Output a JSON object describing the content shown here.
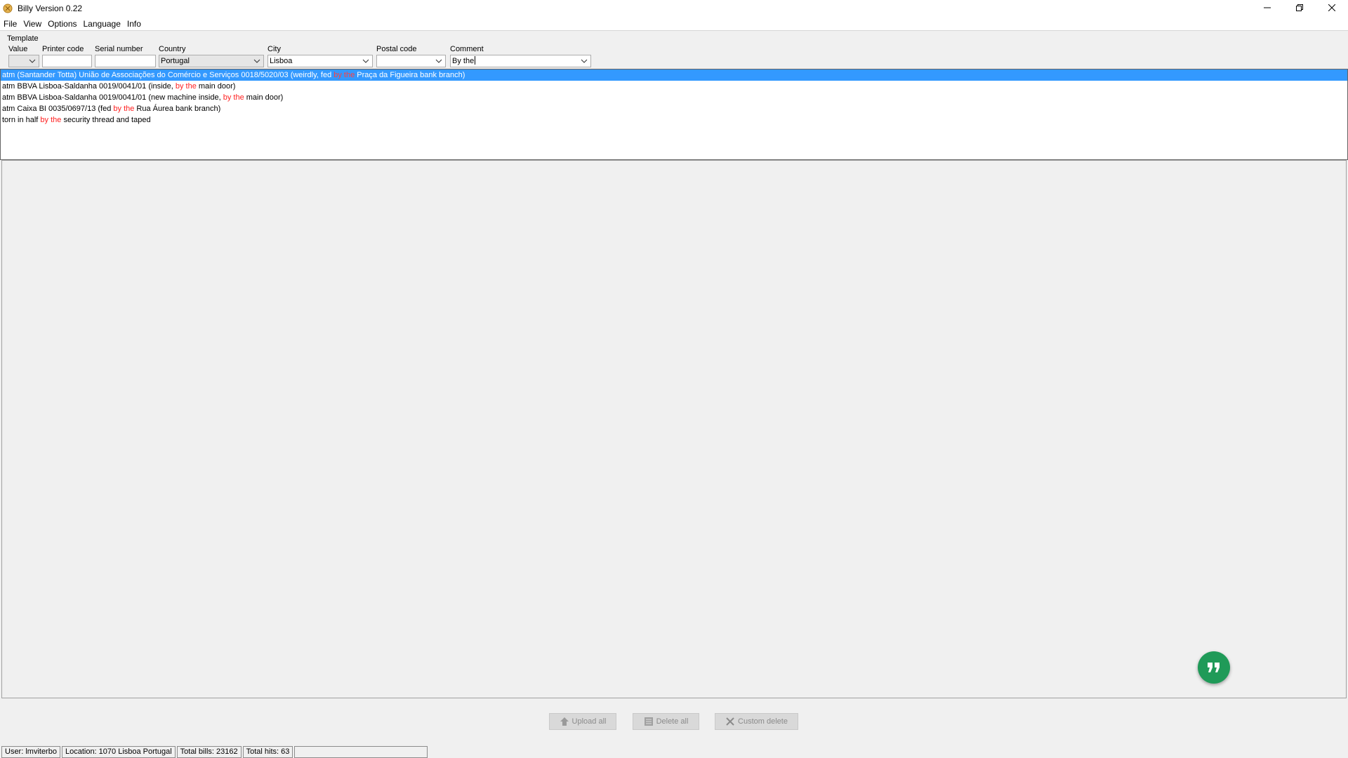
{
  "window": {
    "title": "Billy Version 0.22",
    "app_icon": "billy-app-icon",
    "controls": [
      "minimize-icon",
      "restore-icon",
      "close-icon"
    ]
  },
  "menu": {
    "items": [
      "File",
      "View",
      "Options",
      "Language",
      "Info"
    ]
  },
  "template": {
    "title": "Template",
    "fields": {
      "value": {
        "label": "Value",
        "value": ""
      },
      "printer_code": {
        "label": "Printer code",
        "value": ""
      },
      "serial_number": {
        "label": "Serial number",
        "value": ""
      },
      "country": {
        "label": "Country",
        "value": "Portugal"
      },
      "city": {
        "label": "City",
        "value": "Lisboa"
      },
      "postal_code": {
        "label": "Postal code",
        "value": ""
      },
      "comment": {
        "label": "Comment",
        "value": "By the"
      }
    }
  },
  "suggestions": [
    {
      "before": "atm (Santander Totta) União de Associações do Comércio e Serviços 0018/5020/03 (weirdly, fed ",
      "match": "by the",
      "after": " Praça da Figueira bank branch)",
      "selected": true
    },
    {
      "before": "atm BBVA Lisboa-Saldanha 0019/0041/01 (inside, ",
      "match": "by the",
      "after": " main door)",
      "selected": false
    },
    {
      "before": "atm BBVA Lisboa-Saldanha 0019/0041/01 (new machine inside, ",
      "match": "by the",
      "after": " main door)",
      "selected": false
    },
    {
      "before": "atm Caixa BI 0035/0697/13 (fed ",
      "match": "by the",
      "after": " Rua Áurea bank branch)",
      "selected": false
    },
    {
      "before": "torn in half ",
      "match": "by the",
      "after": " security thread and taped",
      "selected": false
    }
  ],
  "buttons": {
    "upload_all": "Upload all",
    "delete_all": "Delete all",
    "custom_delete": "Custom delete"
  },
  "fab": {
    "icon": "quote-icon",
    "color": "#1f9a58"
  },
  "status": {
    "user": "User: lmviterbo",
    "location": "Location: 1070 Lisboa Portugal",
    "total_bills": "Total bills: 23162",
    "total_hits": "Total hits: 63"
  },
  "colors": {
    "selection": "#3399ff",
    "highlight": "#ff2020"
  }
}
